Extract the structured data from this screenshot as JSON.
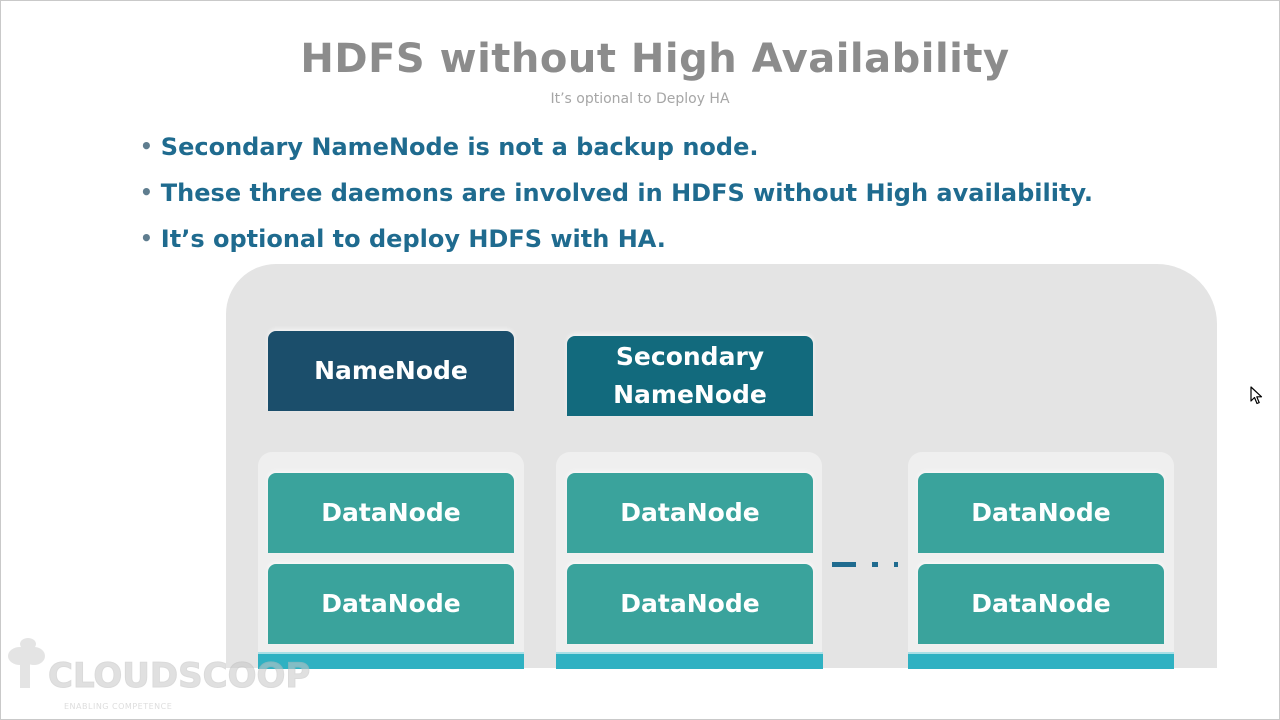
{
  "slide": {
    "title": "HDFS without High Availability",
    "subtitle": "It’s optional to Deploy HA",
    "bullets": [
      "Secondary NameNode is not a backup node.",
      "These three daemons are involved in HDFS without High availability.",
      "It’s optional to deploy HDFS with HA."
    ]
  },
  "diagram": {
    "namenode_label": "NameNode",
    "secondary_line1": "Secondary",
    "secondary_line2": "NameNode",
    "datanode_label": "DataNode"
  },
  "watermark": {
    "brand": "CLOUDSCOOP",
    "tagline": "ENABLING COMPETENCE"
  },
  "colors": {
    "title": "#8c8c8c",
    "bullet_text": "#1f6b8f",
    "namenode": "#1b4e6b",
    "secondary_namenode": "#126a7d",
    "datanode": "#3aa39c",
    "rack_base": "#2fb1c2",
    "panel": "#e4e4e4"
  },
  "icons": [
    "mouse-cursor-icon",
    "cloudscoop-logo-icon"
  ]
}
